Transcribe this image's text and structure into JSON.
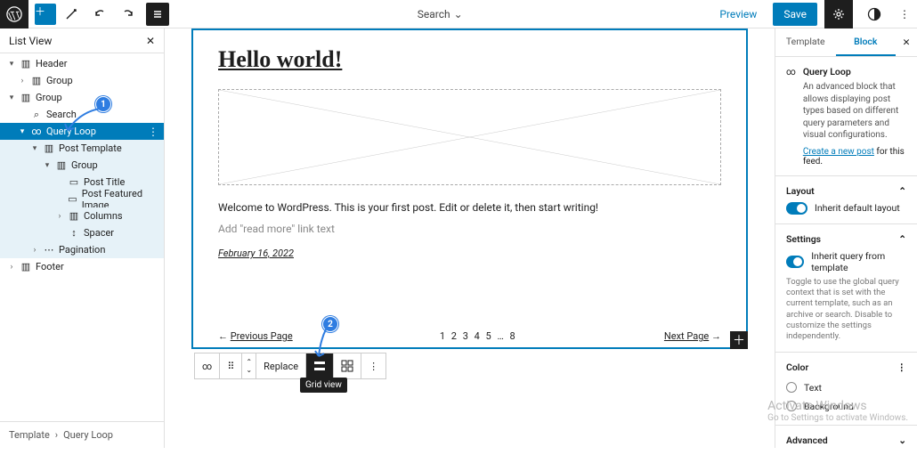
{
  "topbar": {
    "center_label": "Search",
    "preview": "Preview",
    "save": "Save"
  },
  "listview": {
    "title": "List View",
    "items": [
      {
        "label": "Header",
        "chev": "▾",
        "icon": "▥"
      },
      {
        "label": "Group",
        "chev": "›",
        "icon": "▥"
      },
      {
        "label": "Group",
        "chev": "▾",
        "icon": "▥"
      },
      {
        "label": "Search",
        "chev": "",
        "icon": "⌕"
      },
      {
        "label": "Query Loop",
        "chev": "▾",
        "icon": "∞"
      },
      {
        "label": "Post Template",
        "chev": "▾",
        "icon": "▥"
      },
      {
        "label": "Group",
        "chev": "▾",
        "icon": "▥"
      },
      {
        "label": "Post Title",
        "chev": "",
        "icon": "▭"
      },
      {
        "label": "Post Featured Image",
        "chev": "",
        "icon": "▭"
      },
      {
        "label": "Columns",
        "chev": "›",
        "icon": "▥"
      },
      {
        "label": "Spacer",
        "chev": "",
        "icon": "↕"
      },
      {
        "label": "Pagination",
        "chev": "›",
        "icon": "⋯"
      },
      {
        "label": "Footer",
        "chev": "›",
        "icon": "▥"
      }
    ],
    "breadcrumb": {
      "root": "Template",
      "sep": "›",
      "leaf": "Query Loop"
    }
  },
  "canvas": {
    "post_title": "Hello world!",
    "post_body": "Welcome to WordPress. This is your first post. Edit or delete it, then start writing!",
    "readmore_placeholder": "Add \"read more\" link text",
    "post_date": "February 16, 2022",
    "pagination": {
      "prev": "Previous Page",
      "nums": "1 2 3 4 5 … 8",
      "next": "Next Page"
    }
  },
  "toolbar": {
    "replace": "Replace",
    "tooltip": "Grid view"
  },
  "sidebar": {
    "tabs": {
      "template": "Template",
      "block": "Block"
    },
    "block": {
      "name": "Query Loop",
      "desc": "An advanced block that allows displaying post types based on different query parameters and visual configurations.",
      "create_link": "Create a new post",
      "create_tail": " for this feed."
    },
    "layout": {
      "title": "Layout",
      "toggle_label": "Inherit default layout"
    },
    "settings": {
      "title": "Settings",
      "toggle_label": "Inherit query from template",
      "help": "Toggle to use the global query context that is set with the current template, such as an archive or search. Disable to customize the settings independently."
    },
    "color": {
      "title": "Color",
      "opt_text": "Text",
      "opt_bg": "Background"
    },
    "advanced": {
      "title": "Advanced"
    }
  },
  "badges": {
    "b1": "1",
    "b2": "2"
  },
  "watermark": {
    "t1": "Activate Windows",
    "t2": "Go to Settings to activate Windows."
  }
}
